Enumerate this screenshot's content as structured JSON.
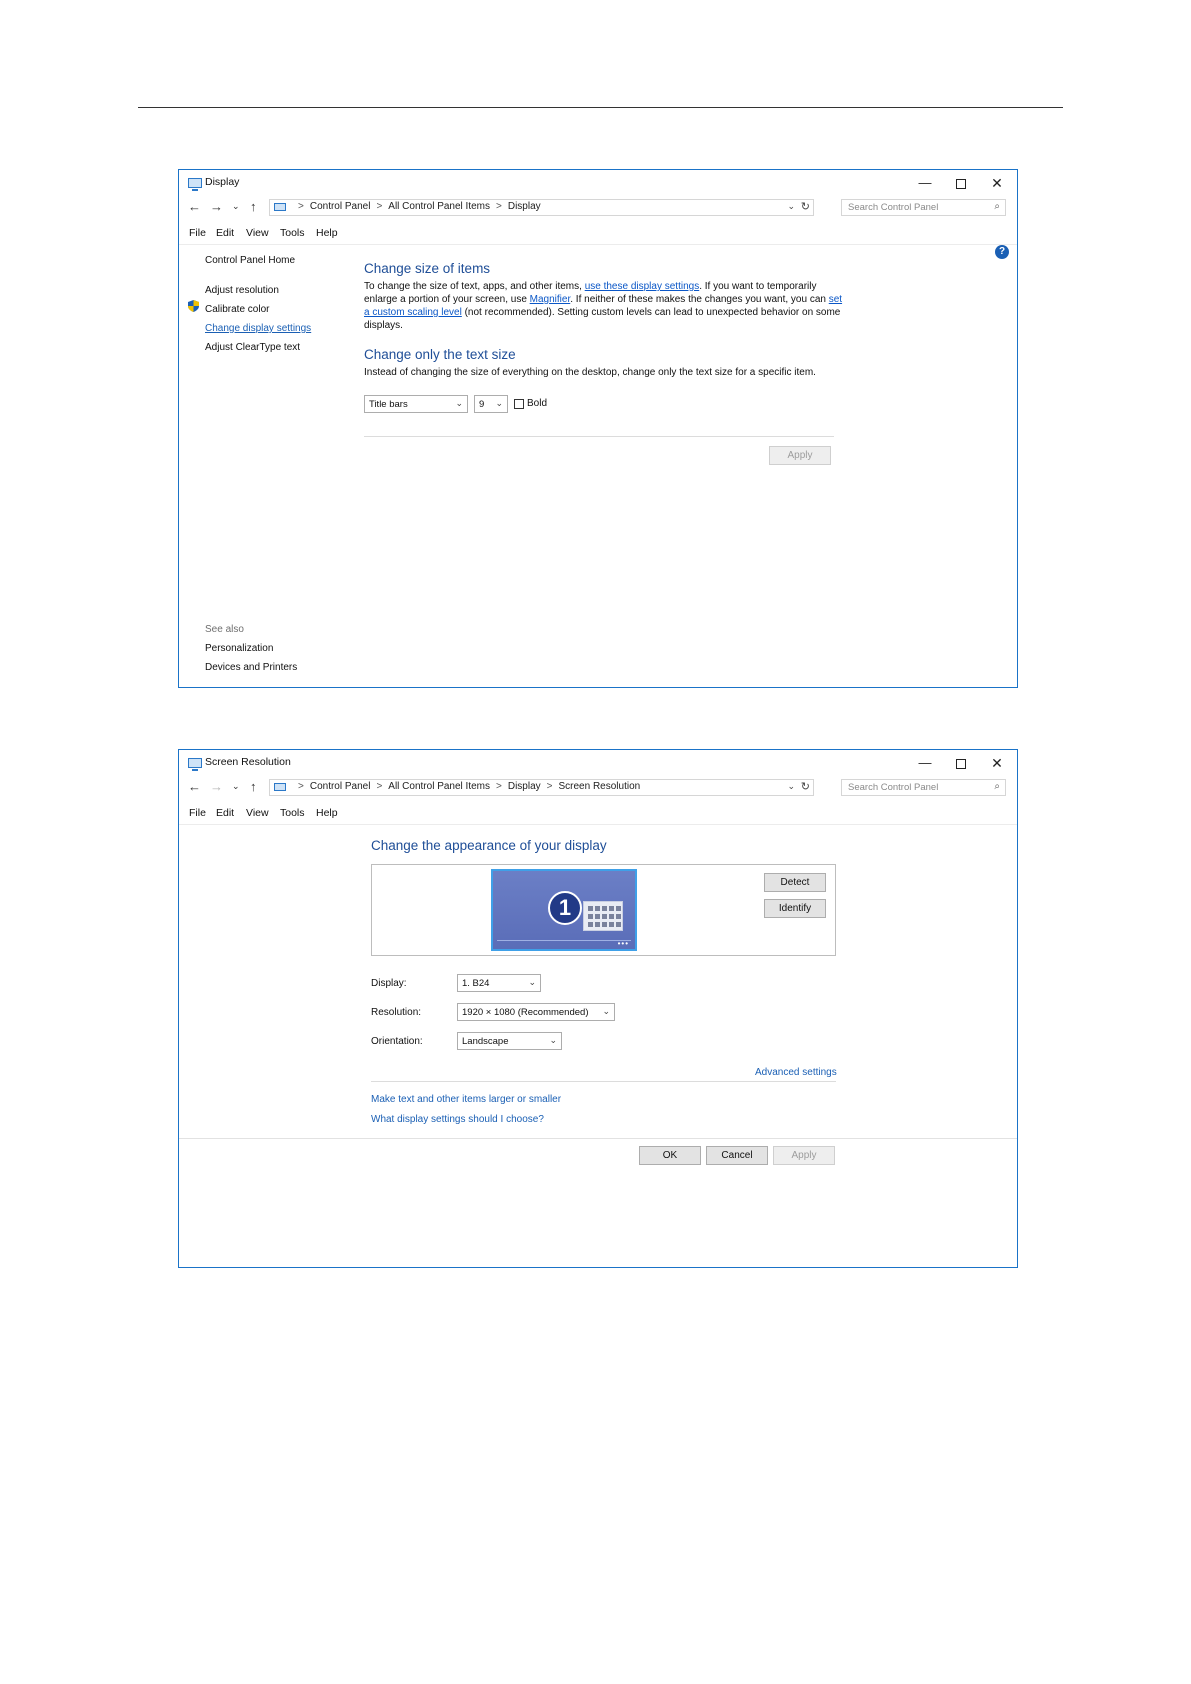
{
  "display_window": {
    "title": "Display",
    "address": {
      "items": [
        "Control Panel",
        "All Control Panel Items",
        "Display"
      ],
      "sep": ">"
    },
    "search_placeholder": "Search Control Panel",
    "menu": [
      "File",
      "Edit",
      "View",
      "Tools",
      "Help"
    ],
    "sidebar": {
      "home": "Control Panel Home",
      "links": [
        "Adjust resolution",
        "Calibrate color",
        "Change display settings",
        "Adjust ClearType text"
      ],
      "see_also": "See also",
      "see_also_links": [
        "Personalization",
        "Devices and Printers"
      ]
    },
    "section1": {
      "heading": "Change size of items",
      "text_a": "To change the size of text, apps, and other items, ",
      "link_a": "use these display settings",
      "text_b": ". If you want to temporarily enlarge a portion of your screen, use ",
      "link_b": "Magnifier",
      "text_c": ". If neither of these makes the changes you want, you can ",
      "link_c": "set a custom scaling level",
      "text_d": " (not recommended). Setting custom levels can lead to unexpected behavior on some displays."
    },
    "section2": {
      "heading": "Change only the text size",
      "text": "Instead of changing the size of everything on the desktop, change only the text size for a specific item."
    },
    "item_select": "Title bars",
    "size_select": "9",
    "bold_label": "Bold",
    "bold_checked": false,
    "apply_label": "Apply"
  },
  "resolution_window": {
    "title": "Screen Resolution",
    "address": {
      "items": [
        "Control Panel",
        "All Control Panel Items",
        "Display",
        "Screen Resolution"
      ],
      "sep": ">"
    },
    "search_placeholder": "Search Control Panel",
    "menu": [
      "File",
      "Edit",
      "View",
      "Tools",
      "Help"
    ],
    "heading": "Change the appearance of your display",
    "monitor_number": "1",
    "detect_label": "Detect",
    "identify_label": "Identify",
    "display_label": "Display:",
    "display_value": "1. B24",
    "resolution_label": "Resolution:",
    "resolution_value": "1920 × 1080 (Recommended)",
    "orientation_label": "Orientation:",
    "orientation_value": "Landscape",
    "advanced_link": "Advanced settings",
    "link1": "Make text and other items larger or smaller",
    "link2": "What display settings should I choose?",
    "ok_label": "OK",
    "cancel_label": "Cancel",
    "apply_label": "Apply"
  },
  "icons": {
    "back": "←",
    "forward": "→",
    "recent": "⌄",
    "up": "↑",
    "dropdown": "⌄",
    "refresh": "↻",
    "search": "⌕",
    "minimize": "—",
    "close": "✕",
    "help": "?"
  },
  "colors": {
    "window_border": "#1a73c8",
    "heading": "#1f4e97",
    "link": "#1a5fb4"
  }
}
